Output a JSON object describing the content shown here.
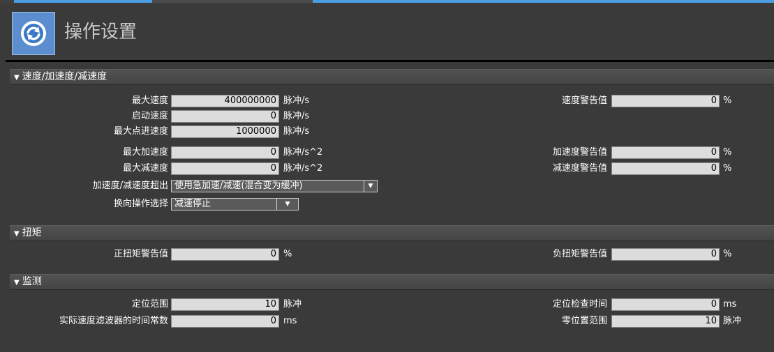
{
  "header": {
    "title": "操作设置",
    "icon": "refresh-settings-icon"
  },
  "sections": {
    "speed": {
      "header": "速度/加速度/减速度",
      "max_speed": {
        "label": "最大速度",
        "value": "400000000",
        "unit": "脉冲/s"
      },
      "start_speed": {
        "label": "启动速度",
        "value": "0",
        "unit": "脉冲/s"
      },
      "max_jog_speed": {
        "label": "最大点进速度",
        "value": "1000000",
        "unit": "脉冲/s"
      },
      "max_accel": {
        "label": "最大加速度",
        "value": "0",
        "unit": "脉冲/s^2"
      },
      "max_decel": {
        "label": "最大减速度",
        "value": "0",
        "unit": "脉冲/s^2"
      },
      "accel_over": {
        "label": "加速度/减速度超出",
        "value": "使用急加速/减速(混合变为缓冲)"
      },
      "reverse_op": {
        "label": "换向操作选择",
        "value": "减速停止"
      },
      "speed_warn": {
        "label": "速度警告值",
        "value": "0",
        "unit": "%"
      },
      "accel_warn": {
        "label": "加速度警告值",
        "value": "0",
        "unit": "%"
      },
      "decel_warn": {
        "label": "减速度警告值",
        "value": "0",
        "unit": "%"
      }
    },
    "torque": {
      "header": "扭矩",
      "pos_warn": {
        "label": "正扭矩警告值",
        "value": "0",
        "unit": "%"
      },
      "neg_warn": {
        "label": "负扭矩警告值",
        "value": "0",
        "unit": "%"
      }
    },
    "monitor": {
      "header": "监测",
      "in_pos_range": {
        "label": "定位范围",
        "value": "10",
        "unit": "脉冲"
      },
      "filter_time": {
        "label": "实际速度滤波器的时间常数",
        "value": "0",
        "unit": "ms"
      },
      "in_pos_check": {
        "label": "定位检查时间",
        "value": "0",
        "unit": "ms"
      },
      "zero_range": {
        "label": "零位置范围",
        "value": "10",
        "unit": "脉冲"
      }
    }
  },
  "colors": {
    "accent": "#4a9de0",
    "field_bg": "#dcdcdc",
    "panel_bg": "#3a3a3a"
  }
}
